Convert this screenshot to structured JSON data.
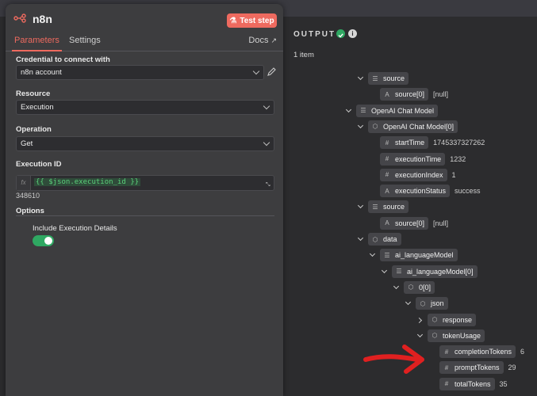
{
  "node": {
    "title": "n8n",
    "test_button": "Test step"
  },
  "tabs": {
    "parameters": "Parameters",
    "settings": "Settings",
    "docs": "Docs"
  },
  "form": {
    "credential_label": "Credential to connect with",
    "credential_value": "n8n account",
    "resource_label": "Resource",
    "resource_value": "Execution",
    "operation_label": "Operation",
    "operation_value": "Get",
    "execution_id_label": "Execution ID",
    "execution_id_expr": "{{ $json.execution_id }}",
    "execution_id_result": "348610",
    "options_label": "Options",
    "include_details_label": "Include Execution Details",
    "include_details_on": true
  },
  "output": {
    "title": "OUTPUT",
    "items_count": "1 item",
    "tree": [
      {
        "caret": "down",
        "type": "list",
        "key": "source",
        "val": "",
        "level": 0
      },
      {
        "caret": "",
        "type": "str",
        "key": "source[0]",
        "val": "[null]",
        "level": 1
      },
      {
        "caret": "down",
        "type": "list",
        "key": "OpenAI Chat Model",
        "val": "",
        "level": -1
      },
      {
        "caret": "down",
        "type": "obj",
        "key": "OpenAI Chat Model[0]",
        "val": "",
        "level": 0
      },
      {
        "caret": "",
        "type": "num",
        "key": "startTime",
        "val": "1745337327262",
        "level": 1
      },
      {
        "caret": "",
        "type": "num",
        "key": "executionTime",
        "val": "1232",
        "level": 1
      },
      {
        "caret": "",
        "type": "num",
        "key": "executionIndex",
        "val": "1",
        "level": 1
      },
      {
        "caret": "",
        "type": "str",
        "key": "executionStatus",
        "val": "success",
        "level": 1
      },
      {
        "caret": "down",
        "type": "list",
        "key": "source",
        "val": "",
        "level": 0
      },
      {
        "caret": "",
        "type": "str",
        "key": "source[0]",
        "val": "[null]",
        "level": 1
      },
      {
        "caret": "down",
        "type": "obj",
        "key": "data",
        "val": "",
        "level": 0
      },
      {
        "caret": "down",
        "type": "list",
        "key": "ai_languageModel",
        "val": "",
        "level": 1
      },
      {
        "caret": "down",
        "type": "list",
        "key": "ai_languageModel[0]",
        "val": "",
        "level": 2
      },
      {
        "caret": "down",
        "type": "obj",
        "key": "0[0]",
        "val": "",
        "level": 3
      },
      {
        "caret": "down",
        "type": "obj",
        "key": "json",
        "val": "",
        "level": 4
      },
      {
        "caret": "right",
        "type": "obj",
        "key": "response",
        "val": "",
        "level": 5
      },
      {
        "caret": "down",
        "type": "obj",
        "key": "tokenUsage",
        "val": "",
        "level": 5
      },
      {
        "caret": "",
        "type": "num",
        "key": "completionTokens",
        "val": "6",
        "level": 6
      },
      {
        "caret": "",
        "type": "num",
        "key": "promptTokens",
        "val": "29",
        "level": 6
      },
      {
        "caret": "",
        "type": "num",
        "key": "totalTokens",
        "val": "35",
        "level": 6
      }
    ]
  },
  "colors": {
    "accent": "#ee6a5f",
    "success": "#2fa862",
    "arrow": "#e02020"
  }
}
